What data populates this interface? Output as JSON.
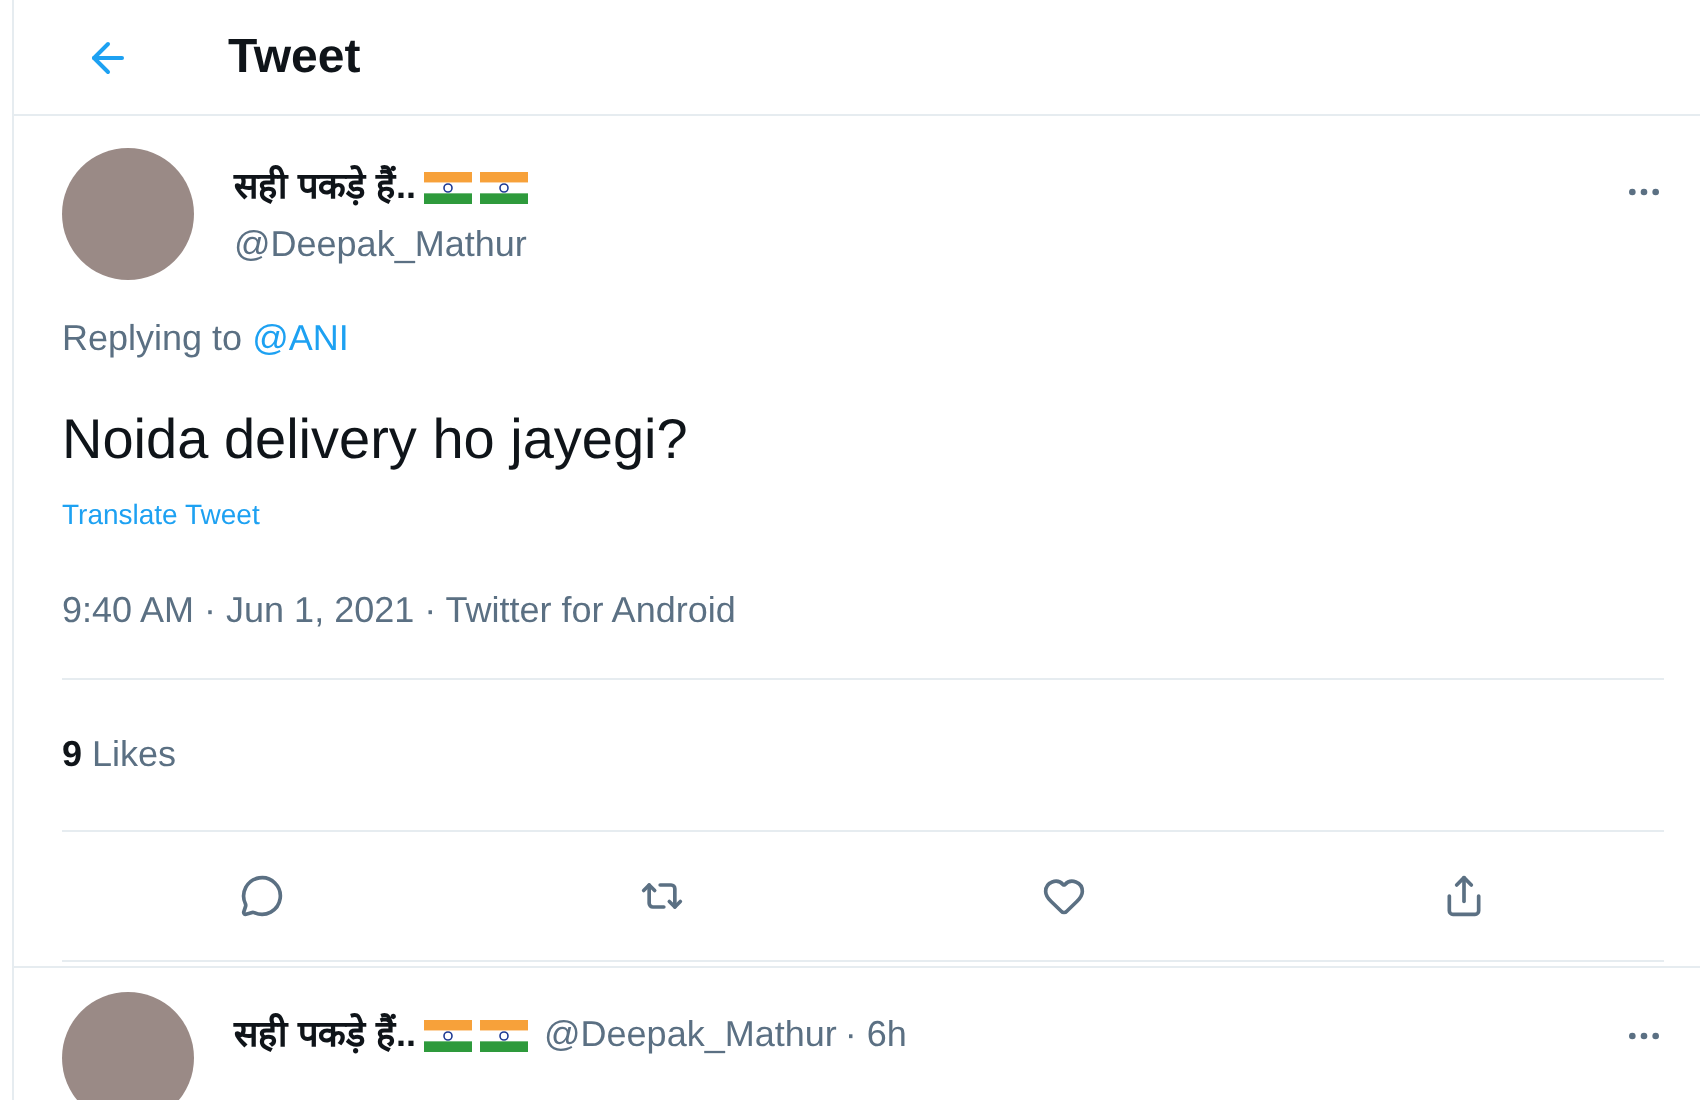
{
  "header": {
    "title": "Tweet"
  },
  "tweet": {
    "display_name": "सही पकड़े हैं..",
    "handle": "@Deepak_Mathur",
    "replying_label": "Replying to",
    "replying_to": "@ANI",
    "text": "Noida delivery ho jayegi?",
    "translate": "Translate Tweet",
    "meta": "9:40 AM · Jun 1, 2021 · Twitter for Android",
    "likes_count": "9",
    "likes_label": "Likes"
  },
  "reply": {
    "display_name": "सही पकड़े हैं..",
    "handle": "@Deepak_Mathur",
    "time": "· 6h"
  }
}
